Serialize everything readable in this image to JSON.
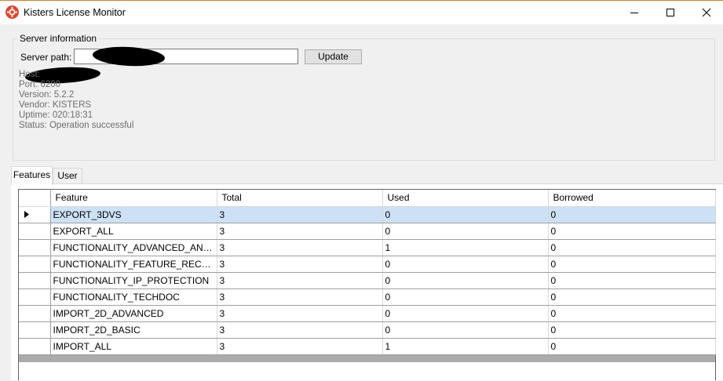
{
  "window": {
    "title": "Kisters License Monitor",
    "controls": [
      "minimize-icon",
      "maximize-icon",
      "close-icon"
    ]
  },
  "server": {
    "group_title": "Server information",
    "path_label": "Server path:",
    "path_value": "",
    "update_label": "Update",
    "info": {
      "host": "Host:",
      "port": "Port: 6200",
      "version": "Version: 5.2.2",
      "vendor": "Vendor: KISTERS",
      "uptime": "Uptime: 020:18:31",
      "status": "Status: Operation successful"
    }
  },
  "tabs": [
    {
      "label": "Features",
      "active": true
    },
    {
      "label": "User",
      "active": false
    }
  ],
  "table": {
    "columns": [
      "Feature",
      "Total",
      "Used",
      "Borrowed"
    ],
    "rows": [
      [
        "EXPORT_3DVS",
        "3",
        "0",
        "0"
      ],
      [
        "EXPORT_ALL",
        "3",
        "0",
        "0"
      ],
      [
        "FUNCTIONALITY_ADVANCED_ANA...",
        "3",
        "1",
        "0"
      ],
      [
        "FUNCTIONALITY_FEATURE_RECO...",
        "3",
        "0",
        "0"
      ],
      [
        "FUNCTIONALITY_IP_PROTECTION",
        "3",
        "0",
        "0"
      ],
      [
        "FUNCTIONALITY_TECHDOC",
        "3",
        "0",
        "0"
      ],
      [
        "IMPORT_2D_ADVANCED",
        "3",
        "0",
        "0"
      ],
      [
        "IMPORT_2D_BASIC",
        "3",
        "0",
        "0"
      ],
      [
        "IMPORT_ALL",
        "3",
        "1",
        "0"
      ]
    ],
    "selected_row": 0
  },
  "colors": {
    "selection": "#cde1f6",
    "app_icon": "#e0442c",
    "info_text": "#6d6d6d"
  }
}
